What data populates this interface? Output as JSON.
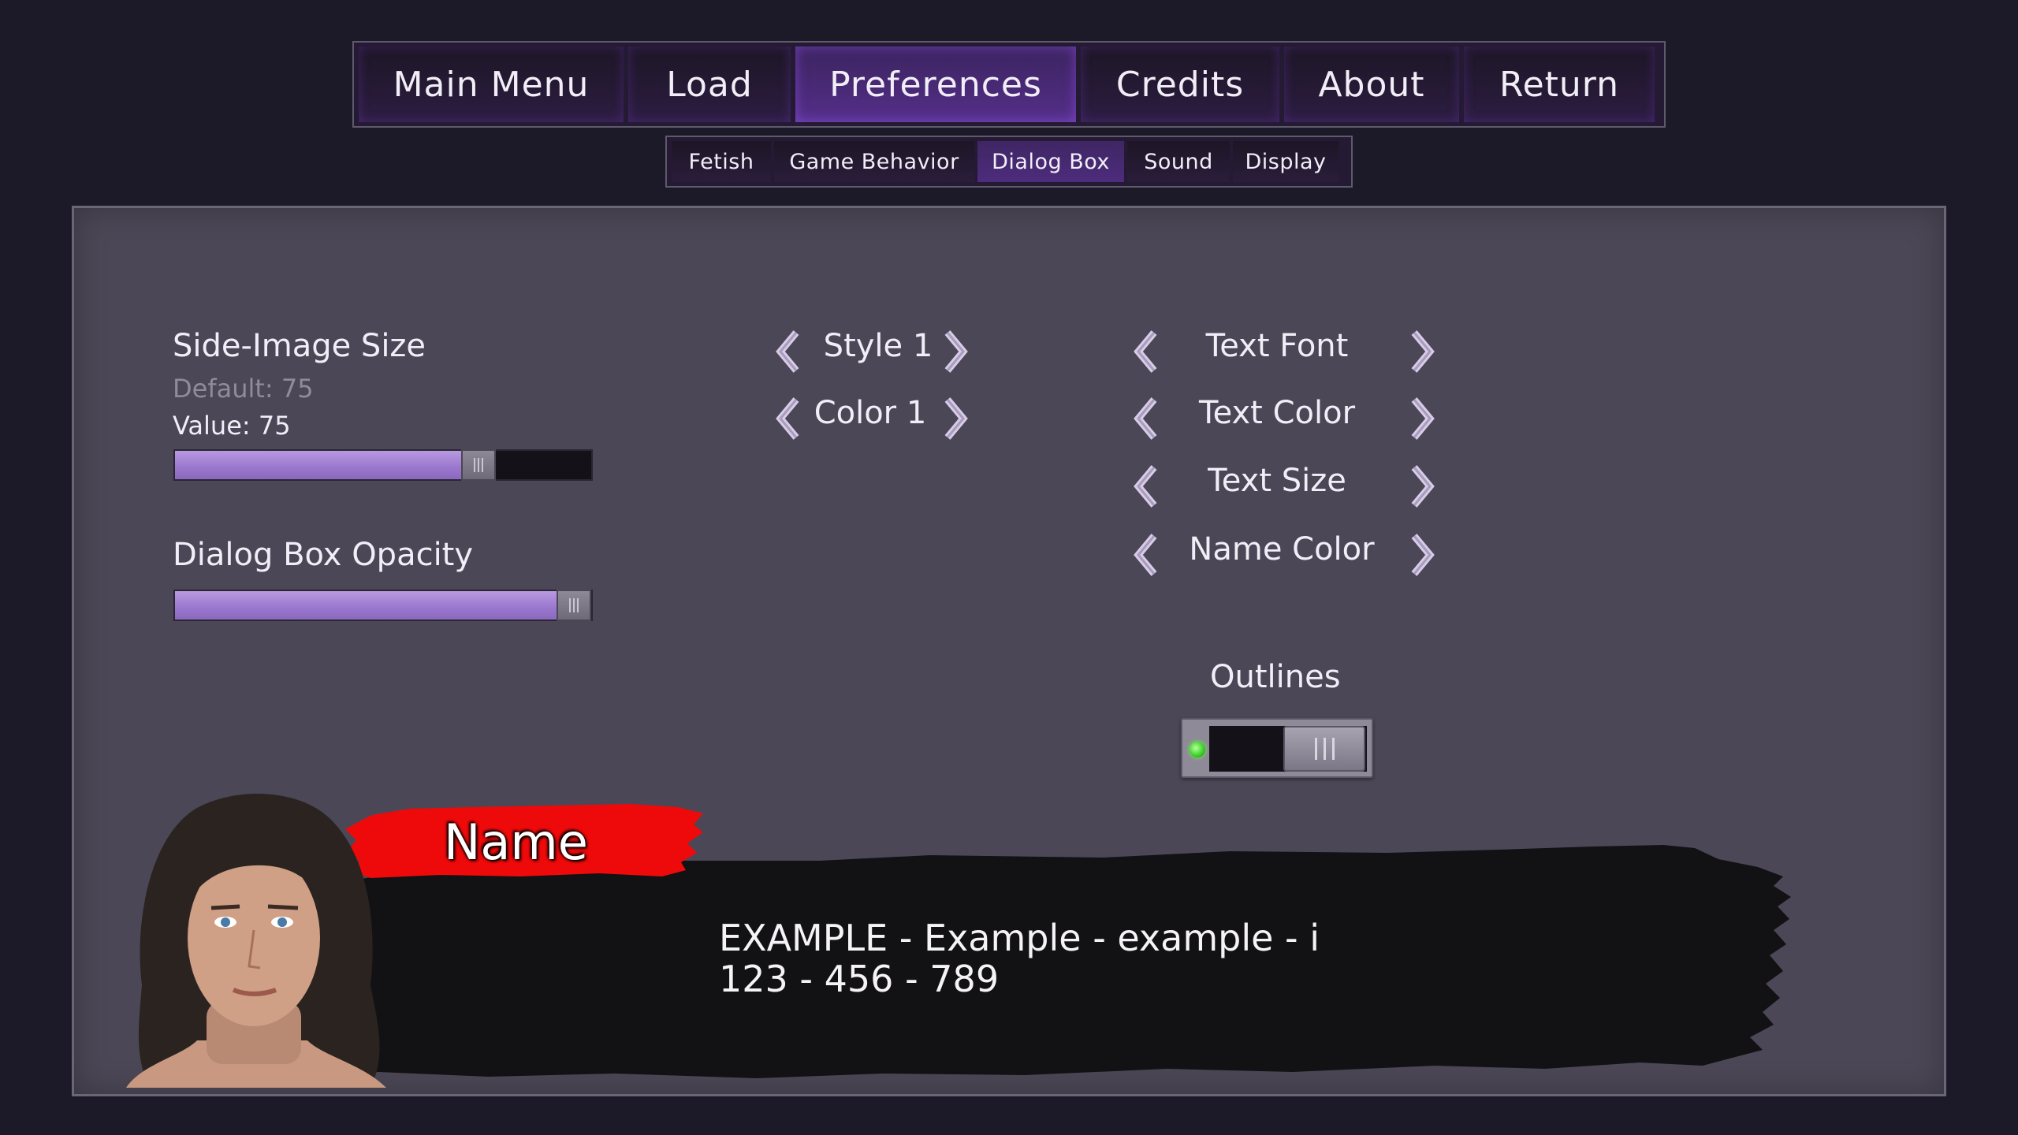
{
  "topnav": {
    "tabs": [
      {
        "label": "Main Menu",
        "active": false
      },
      {
        "label": "Load",
        "active": false
      },
      {
        "label": "Preferences",
        "active": true
      },
      {
        "label": "Credits",
        "active": false
      },
      {
        "label": "About",
        "active": false
      },
      {
        "label": "Return",
        "active": false
      }
    ]
  },
  "subnav": {
    "tabs": [
      {
        "label": "Fetish",
        "active": false
      },
      {
        "label": "Game Behavior",
        "active": false
      },
      {
        "label": "Dialog Box",
        "active": true
      },
      {
        "label": "Sound",
        "active": false
      },
      {
        "label": "Display",
        "active": false
      }
    ]
  },
  "side_image": {
    "title": "Side-Image Size",
    "default_text": "Default: 75",
    "value_text": "Value: 75",
    "fraction": 0.75
  },
  "opacity": {
    "title": "Dialog Box Opacity",
    "fraction": 1.0
  },
  "style_selectors": [
    {
      "label": "Style 1"
    },
    {
      "label": "Color 1"
    }
  ],
  "text_selectors": [
    {
      "label": "Text Font"
    },
    {
      "label": "Text Color"
    },
    {
      "label": "Text Size"
    },
    {
      "label": "Name Color"
    }
  ],
  "outlines": {
    "title": "Outlines",
    "enabled": true
  },
  "preview": {
    "name": "Name",
    "line1": "EXAMPLE - Example - example - i",
    "line2": "123 - 456 - 789"
  },
  "colors": {
    "background": "#1c1a29",
    "panel": "#4b4756",
    "accent_purple": "#9c79cf",
    "name_tag_red": "#ee0a0a",
    "led_green": "#3fd42c"
  }
}
